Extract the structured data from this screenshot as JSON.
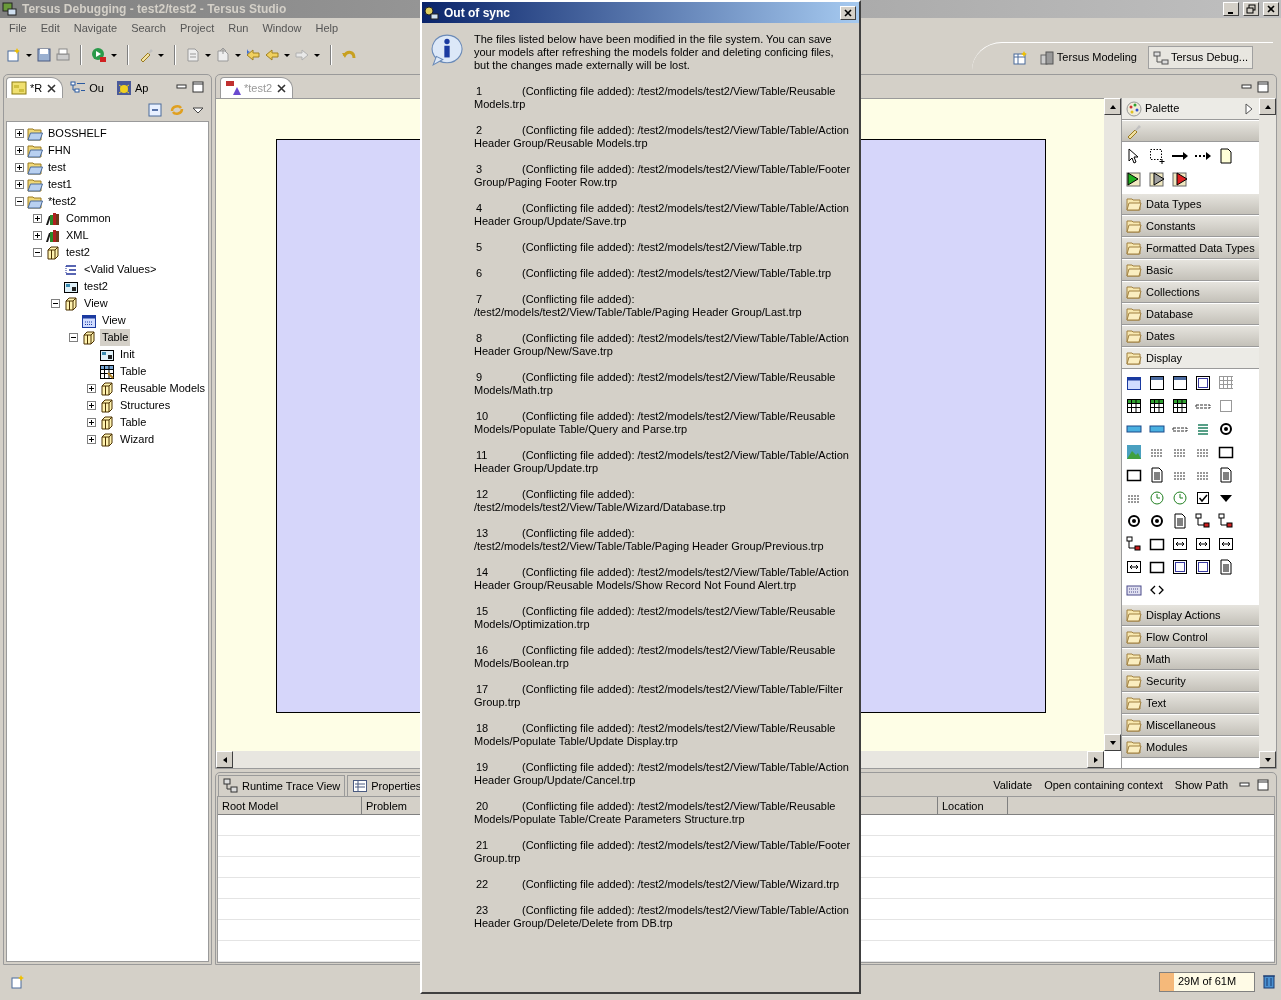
{
  "window": {
    "title": "Tersus Debugging - test2/test2 - Tersus Studio"
  },
  "menu": [
    "File",
    "Edit",
    "Navigate",
    "Search",
    "Project",
    "Run",
    "Window",
    "Help"
  ],
  "perspectives": [
    {
      "label": "Tersus Modeling",
      "selected": false
    },
    {
      "label": "Tersus Debug...",
      "selected": true
    }
  ],
  "left_panel": {
    "tabs": [
      {
        "label": "*R",
        "selected": true
      },
      {
        "label": "Ou",
        "selected": false
      },
      {
        "label": "Ap",
        "selected": false
      }
    ],
    "tree": [
      {
        "label": "BOSSHELF",
        "kind": "folder",
        "expanded": false,
        "selected": false
      },
      {
        "label": "FHN",
        "kind": "folder",
        "expanded": false,
        "selected": false
      },
      {
        "label": "test",
        "kind": "folder",
        "expanded": false,
        "selected": false
      },
      {
        "label": "test1",
        "kind": "folder",
        "expanded": false,
        "selected": false
      },
      {
        "label": "*test2",
        "kind": "folder",
        "expanded": true,
        "selected": false,
        "children": [
          {
            "label": "Common",
            "kind": "library",
            "expanded": false,
            "selected": false
          },
          {
            "label": "XML",
            "kind": "library",
            "expanded": false,
            "selected": false
          },
          {
            "label": "test2",
            "kind": "package",
            "expanded": true,
            "selected": false,
            "children": [
              {
                "label": "<Valid Values>",
                "kind": "values",
                "selected": false
              },
              {
                "label": "test2",
                "kind": "display",
                "selected": false
              },
              {
                "label": "View",
                "kind": "package",
                "expanded": true,
                "selected": false,
                "children": [
                  {
                    "label": "View",
                    "kind": "view",
                    "selected": false
                  },
                  {
                    "label": "Table",
                    "kind": "package",
                    "expanded": true,
                    "selected": true,
                    "children": [
                      {
                        "label": "Init",
                        "kind": "display",
                        "selected": false
                      },
                      {
                        "label": "Table",
                        "kind": "table",
                        "selected": false
                      },
                      {
                        "label": "Reusable Models",
                        "kind": "package",
                        "expanded": false,
                        "selected": false
                      },
                      {
                        "label": "Structures",
                        "kind": "package",
                        "expanded": false,
                        "selected": false
                      },
                      {
                        "label": "Table",
                        "kind": "package",
                        "expanded": false,
                        "selected": false
                      },
                      {
                        "label": "Wizard",
                        "kind": "package",
                        "expanded": false,
                        "selected": false
                      }
                    ]
                  }
                ]
              }
            ]
          }
        ]
      }
    ]
  },
  "editor": {
    "tabs": [
      {
        "label": "*test2",
        "selected": true
      }
    ]
  },
  "palette": {
    "title": "Palette",
    "drawers": [
      {
        "label": "Data Types",
        "expanded": false
      },
      {
        "label": "Constants",
        "expanded": false
      },
      {
        "label": "Formatted Data Types",
        "expanded": false
      },
      {
        "label": "Basic",
        "expanded": false
      },
      {
        "label": "Collections",
        "expanded": false
      },
      {
        "label": "Database",
        "expanded": false
      },
      {
        "label": "Dates",
        "expanded": false
      },
      {
        "label": "Display",
        "expanded": true
      },
      {
        "label": "Display Actions",
        "expanded": false
      },
      {
        "label": "Flow Control",
        "expanded": false
      },
      {
        "label": "Math",
        "expanded": false
      },
      {
        "label": "Security",
        "expanded": false
      },
      {
        "label": "Text",
        "expanded": false
      },
      {
        "label": "Miscellaneous",
        "expanded": false
      },
      {
        "label": "Modules",
        "expanded": false
      }
    ]
  },
  "bottom_panel": {
    "tabs": [
      {
        "label": "Runtime Trace View",
        "selected": false
      },
      {
        "label": "Properties",
        "selected": false
      }
    ],
    "actions": [
      "Validate",
      "Open containing context",
      "Show Path"
    ],
    "columns": [
      "Root Model",
      "Problem",
      "Location"
    ]
  },
  "status_bar": {
    "heap": "29M of 61M",
    "level": 0.15
  },
  "dialog": {
    "title": "Out of sync",
    "message": "The files listed below have been modified in the file system. You can save your models after refreshing the models folder and deleting conficing files, but the changes made externally will be lost.",
    "entries": [
      {
        "number": "1",
        "text": "(Conflicting file added): /test2/models/test2/View/Table/Reusable Models.trp"
      },
      {
        "number": "2",
        "text": "(Conflicting file added): /test2/models/test2/View/Table/Table/Action Header Group/Reusable Models.trp"
      },
      {
        "number": "3",
        "text": "(Conflicting file added): /test2/models/test2/View/Table/Table/Footer Group/Paging Footer Row.trp"
      },
      {
        "number": "4",
        "text": "(Conflicting file added): /test2/models/test2/View/Table/Table/Action Header Group/Update/Save.trp"
      },
      {
        "number": "5",
        "text": "(Conflicting file added): /test2/models/test2/View/Table.trp"
      },
      {
        "number": "6",
        "text": "(Conflicting file added): /test2/models/test2/View/Table/Table.trp"
      },
      {
        "number": "7",
        "text": "(Conflicting file added): /test2/models/test2/View/Table/Table/Paging Header Group/Last.trp"
      },
      {
        "number": "8",
        "text": "(Conflicting file added): /test2/models/test2/View/Table/Table/Action Header Group/New/Save.trp"
      },
      {
        "number": "9",
        "text": "(Conflicting file added): /test2/models/test2/View/Table/Reusable Models/Math.trp"
      },
      {
        "number": "10",
        "text": "(Conflicting file added): /test2/models/test2/View/Table/Reusable Models/Populate Table/Query and Parse.trp"
      },
      {
        "number": "11",
        "text": "(Conflicting file added): /test2/models/test2/View/Table/Table/Action Header Group/Update.trp"
      },
      {
        "number": "12",
        "text": "(Conflicting file added): /test2/models/test2/View/Table/Wizard/Database.trp"
      },
      {
        "number": "13",
        "text": "(Conflicting file added): /test2/models/test2/View/Table/Table/Paging Header Group/Previous.trp"
      },
      {
        "number": "14",
        "text": "(Conflicting file added): /test2/models/test2/View/Table/Table/Action Header Group/Reusable Models/Show Record Not Found Alert.trp"
      },
      {
        "number": "15",
        "text": "(Conflicting file added): /test2/models/test2/View/Table/Reusable Models/Optimization.trp"
      },
      {
        "number": "16",
        "text": "(Conflicting file added): /test2/models/test2/View/Table/Reusable Models/Boolean.trp"
      },
      {
        "number": "17",
        "text": "(Conflicting file added): /test2/models/test2/View/Table/Table/Filter Group.trp"
      },
      {
        "number": "18",
        "text": "(Conflicting file added): /test2/models/test2/View/Table/Reusable Models/Populate Table/Update Display.trp"
      },
      {
        "number": "19",
        "text": "(Conflicting file added): /test2/models/test2/View/Table/Table/Action Header Group/Update/Cancel.trp"
      },
      {
        "number": "20",
        "text": "(Conflicting file added): /test2/models/test2/View/Table/Reusable Models/Populate Table/Create Parameters Structure.trp"
      },
      {
        "number": "21",
        "text": "(Conflicting file added): /test2/models/test2/View/Table/Table/Footer Group.trp"
      },
      {
        "number": "22",
        "text": "(Conflicting file added): /test2/models/test2/View/Table/Wizard.trp"
      },
      {
        "number": "23",
        "text": "(Conflicting file added): /test2/models/test2/View/Table/Table/Action Header Group/Delete/Delete from DB.trp"
      }
    ]
  }
}
